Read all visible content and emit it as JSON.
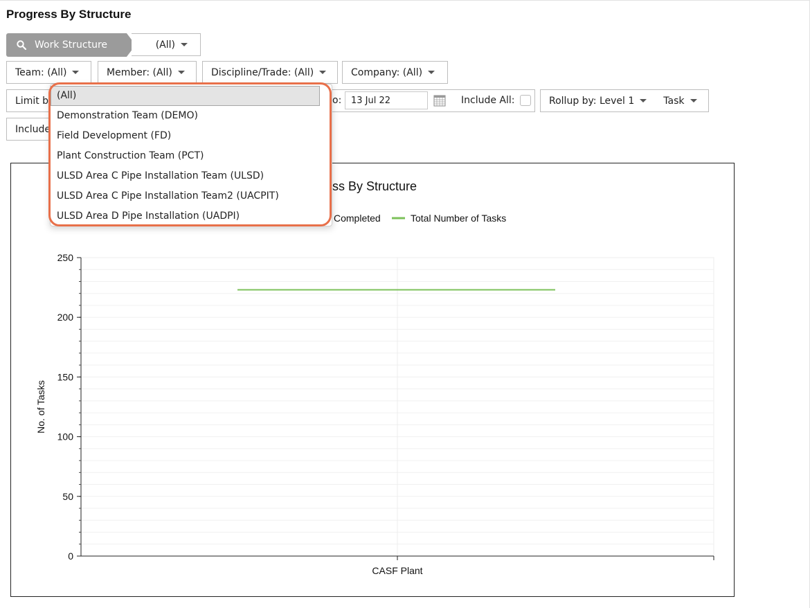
{
  "page_title": "Progress By Structure",
  "work_structure": {
    "label": "Work Structure",
    "value": "(All)"
  },
  "filters_row1": [
    {
      "name": "team-filter",
      "label": "Team:",
      "value": "(All)"
    },
    {
      "name": "member-filter",
      "label": "Member:",
      "value": "(All)"
    },
    {
      "name": "discipline-filter",
      "label": "Discipline/Trade:",
      "value": "(All)"
    },
    {
      "name": "company-filter",
      "label": "Company:",
      "value": "(All)"
    }
  ],
  "filters_row2": {
    "limit_label": "Limit by",
    "to_label": "o:",
    "date_value": "13 Jul 22",
    "include_all_label": "Include All:",
    "rollup_label": "Rollup by:",
    "rollup_value": "Level 1",
    "rollup_type": "Task"
  },
  "filters_row3": {
    "include_label": "Include"
  },
  "team_dropdown": {
    "items": [
      "(All)",
      "Demonstration Team (DEMO)",
      "Field Development (FD)",
      "Plant Construction Team (PCT)",
      "ULSD Area C Pipe Installation Team (ULSD)",
      "ULSD Area C Pipe Installation Team2 (UACPIT)",
      "ULSD Area D Pipe Installation (UADPI)"
    ],
    "selected_index": 0
  },
  "colors": {
    "highlight": "#e8704a",
    "total_series": "#7cc15a",
    "pill": "#9b9b9b"
  },
  "chart_data": {
    "type": "line",
    "title": "ress By Structure",
    "categories": [
      "CASF Plant"
    ],
    "series": [
      {
        "name": "Completed",
        "values": [
          0
        ]
      },
      {
        "name": "Total Number of Tasks",
        "values": [
          223
        ]
      }
    ],
    "legend_visible": [
      "Completed",
      "Total Number of Tasks"
    ],
    "ylabel": "No. of Tasks",
    "xlabel": "",
    "ylim": [
      0,
      250
    ],
    "yticks": [
      0,
      50,
      100,
      150,
      200,
      250
    ],
    "grid": true,
    "legend_position": "top"
  }
}
